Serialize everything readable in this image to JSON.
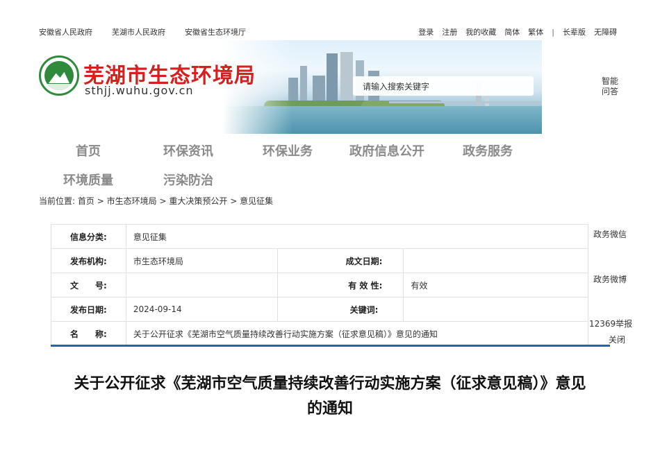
{
  "top_links": [
    "安徽省人民政府",
    "芜湖市人民政府",
    "安徽省生态环境厅"
  ],
  "user_links": {
    "login": "登录",
    "register": "注册",
    "favorites": "我的收藏",
    "simplified": "简体",
    "traditional": "繁体",
    "separator": "|",
    "elder": "长辈版",
    "accessibility": "无障碍"
  },
  "header": {
    "title": "芜湖市生态环境局",
    "domain": "sthjj.wuhu.gov.cn"
  },
  "search": {
    "placeholder": "请输入搜索关键字"
  },
  "side_ai": {
    "line1": "智能",
    "line2": "问答"
  },
  "nav": {
    "row1": [
      "首页",
      "环保资讯",
      "环保业务",
      "政府信息公开",
      "政务服务"
    ],
    "row2": [
      "环境质量",
      "污染防治"
    ]
  },
  "breadcrumb": {
    "prefix": "当前位置:",
    "items": [
      "首页",
      "市生态环境局",
      "重大决策预公开",
      "意见征集"
    ],
    "sep": ">"
  },
  "info": {
    "category_label": "信息分类:",
    "category": "意见征集",
    "publisher_label": "发布机构:",
    "publisher": "市生态环境局",
    "date_made_label": "成文日期:",
    "date_made": "",
    "doc_no_label": "文　　号:",
    "doc_no": "",
    "validity_label": "有 效 性:",
    "validity": "有效",
    "pub_date_label": "发布日期:",
    "pub_date": "2024-09-14",
    "keywords_label": "关键词:",
    "keywords": "",
    "name_label": "名　　称:",
    "name": "关于公开征求《芜湖市空气质量持续改善行动实施方案（征求意见稿）》意见的通知"
  },
  "side_links": {
    "wechat": "政务微信",
    "weibo": "政务微博",
    "report": "12369举报",
    "close": "关闭"
  },
  "article": {
    "title": "关于公开征求《芜湖市空气质量持续改善行动实施方案（征求意见稿）》意见的通知"
  }
}
